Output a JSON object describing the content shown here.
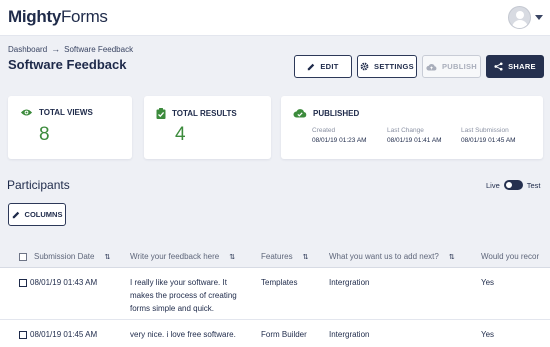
{
  "app": {
    "logo_text_bold": "Mighty",
    "logo_text_rest": "Forms"
  },
  "breadcrumb": {
    "items": [
      "Dashboard",
      "Software Feedback"
    ]
  },
  "page": {
    "title": "Software Feedback"
  },
  "toolbar": {
    "edit_label": "EDIT",
    "settings_label": "SETTINGS",
    "publish_label": "PUBLISH",
    "share_label": "SHARE"
  },
  "stats": {
    "views": {
      "label": "TOTAL VIEWS",
      "value": "8",
      "icon": "eye-icon"
    },
    "results": {
      "label": "TOTAL RESULTS",
      "value": "4",
      "icon": "clipboard-check-icon"
    },
    "published": {
      "label": "PUBLISHED",
      "icon": "cloud-check-icon",
      "created_label": "Created",
      "created_value": "08/01/19 01:23 AM",
      "last_change_label": "Last Change",
      "last_change_value": "08/01/19 01:41 AM",
      "last_submission_label": "Last Submission",
      "last_submission_value": "08/01/19 01:45 AM"
    }
  },
  "participants": {
    "title": "Participants",
    "mode_live": "Live",
    "mode_test": "Test",
    "columns_label": "COLUMNS"
  },
  "table": {
    "headers": [
      "Submission Date",
      "Write your feedback here",
      "Features",
      "What you want us to add next?",
      "Would you recor"
    ],
    "rows": [
      [
        "08/01/19 01:43 AM",
        "I really like your software. It makes the process of creating forms simple and quick.",
        "Templates",
        "Intergration",
        "Yes"
      ],
      [
        "08/01/19 01:45 AM",
        "very nice. i love free software.",
        "Form Builder",
        "Intergration",
        "Yes"
      ]
    ]
  },
  "colors": {
    "navy": "#25304f",
    "accent_green": "#3c8b3c",
    "background": "#eef0f5"
  }
}
